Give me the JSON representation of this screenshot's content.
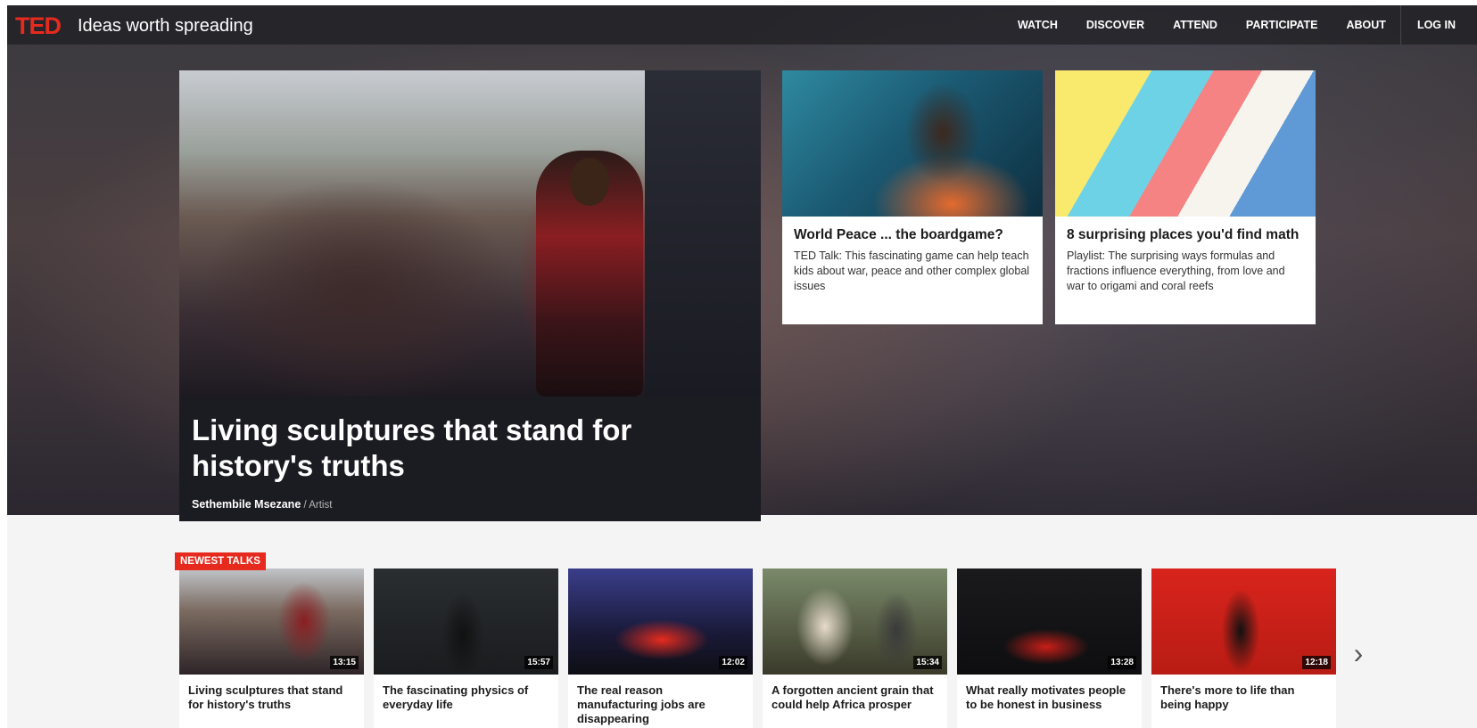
{
  "nav": {
    "logo": "TED",
    "tagline": "Ideas worth spreading",
    "links": [
      "WATCH",
      "DISCOVER",
      "ATTEND",
      "PARTICIPATE",
      "ABOUT"
    ],
    "login": "LOG IN"
  },
  "feature": {
    "title": "Living sculptures that stand for history's truths",
    "speaker": "Sethembile Msezane",
    "separator": " / ",
    "role": "Artist"
  },
  "cards": [
    {
      "title": "World Peace ... the boardgame?",
      "description": "TED Talk: This fascinating game can help teach kids about war, peace and other complex global issues"
    },
    {
      "title": "8 surprising places you'd find math",
      "description": "Playlist: The surprising ways formulas and fractions influence everything, from love and war to origami and coral reefs"
    }
  ],
  "newest": {
    "badge": "NEWEST TALKS",
    "talks": [
      {
        "title": "Living sculptures that stand for history's truths",
        "duration": "13:15"
      },
      {
        "title": "The fascinating physics of everyday life",
        "duration": "15:57"
      },
      {
        "title": "The real reason manufacturing jobs are disappearing",
        "duration": "12:02"
      },
      {
        "title": "A forgotten ancient grain that could help Africa prosper",
        "duration": "15:34"
      },
      {
        "title": "What really motivates people to be honest in business",
        "duration": "13:28"
      },
      {
        "title": "There's more to life than being happy",
        "duration": "12:18"
      }
    ],
    "next_icon": "chevron-right-icon"
  },
  "colors": {
    "brand_red": "#e62b1e"
  }
}
